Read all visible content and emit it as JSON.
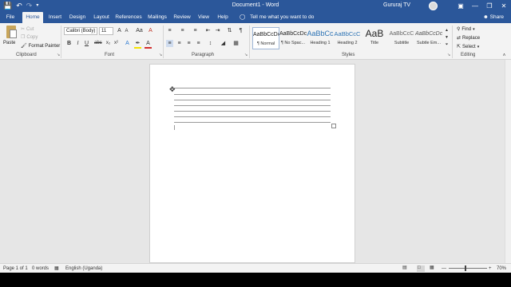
{
  "title_bar": {
    "qat": {
      "save_icon": "save-icon",
      "undo_icon": "undo-icon",
      "redo_icon": "redo-icon",
      "customize_icon": "customize-qat-icon"
    },
    "document_title": "Document1 - Word",
    "user_name": "Gururaj TV",
    "window_buttons": [
      "ribbon-display-options-icon",
      "minimize-icon",
      "restore-icon",
      "close-icon"
    ]
  },
  "tabs": [
    "File",
    "Home",
    "Insert",
    "Design",
    "Layout",
    "References",
    "Mailings",
    "Review",
    "View",
    "Help"
  ],
  "active_tab": "Home",
  "tell_me": "Tell me what you want to do",
  "share": "Share",
  "ribbon": {
    "clipboard": {
      "label": "Clipboard",
      "paste": "Paste",
      "cut": "Cut",
      "copy": "Copy",
      "format_painter": "Format Painter"
    },
    "font": {
      "label": "Font",
      "font_name": "Calibri (Body)",
      "font_size": "11"
    },
    "paragraph": {
      "label": "Paragraph"
    },
    "styles": {
      "label": "Styles",
      "items": [
        {
          "sample": "AaBbCcDc",
          "name": "¶ Normal"
        },
        {
          "sample": "AaBbCcDc",
          "name": "¶ No Spac..."
        },
        {
          "sample": "AaBbCc",
          "name": "Heading 1"
        },
        {
          "sample": "AaBbCcC",
          "name": "Heading 2"
        },
        {
          "sample": "AaB",
          "name": "Title"
        },
        {
          "sample": "AaBbCcC",
          "name": "Subtitle"
        },
        {
          "sample": "AaBbCcDc",
          "name": "Subtle Em..."
        }
      ]
    },
    "editing": {
      "label": "Editing",
      "find": "Find",
      "replace": "Replace",
      "select": "Select"
    }
  },
  "status": {
    "page": "Page 1 of 1",
    "words": "0 words",
    "language": "English (Uganda)",
    "zoom": "70%",
    "zoom_fraction": 0.43
  },
  "colors": {
    "accent": "#2b579a",
    "highlight": "#f5e200",
    "font_color": "#d32f2f"
  }
}
